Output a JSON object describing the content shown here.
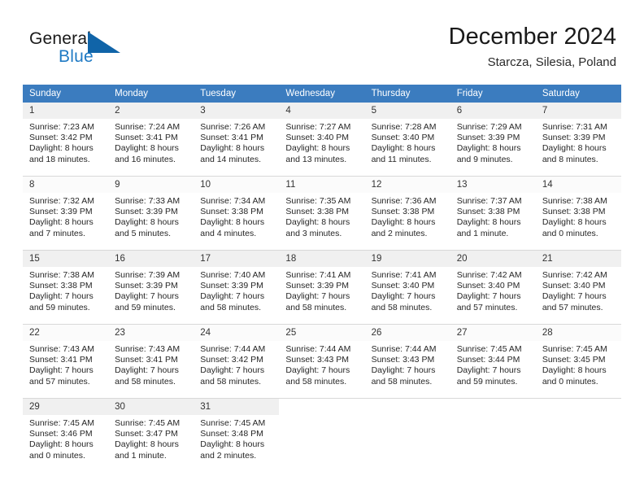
{
  "brand": {
    "line1": "General",
    "line2": "Blue",
    "mark": "triangle-logo"
  },
  "header": {
    "title": "December 2024",
    "subtitle": "Starcza, Silesia, Poland"
  },
  "colors": {
    "header_blue": "#3b7cbf",
    "brand_blue": "#1f7ac4",
    "daynum_band": "#f0f0f0",
    "row_divider": "#d8d8d8"
  },
  "weekdays": [
    "Sunday",
    "Monday",
    "Tuesday",
    "Wednesday",
    "Thursday",
    "Friday",
    "Saturday"
  ],
  "labels": {
    "sunrise_prefix": "Sunrise:",
    "sunset_prefix": "Sunset:",
    "daylight_prefix": "Daylight:"
  },
  "weeks": [
    [
      {
        "day": "1",
        "sunrise": "Sunrise: 7:23 AM",
        "sunset": "Sunset: 3:42 PM",
        "daylight1": "Daylight: 8 hours",
        "daylight2": "and 18 minutes."
      },
      {
        "day": "2",
        "sunrise": "Sunrise: 7:24 AM",
        "sunset": "Sunset: 3:41 PM",
        "daylight1": "Daylight: 8 hours",
        "daylight2": "and 16 minutes."
      },
      {
        "day": "3",
        "sunrise": "Sunrise: 7:26 AM",
        "sunset": "Sunset: 3:41 PM",
        "daylight1": "Daylight: 8 hours",
        "daylight2": "and 14 minutes."
      },
      {
        "day": "4",
        "sunrise": "Sunrise: 7:27 AM",
        "sunset": "Sunset: 3:40 PM",
        "daylight1": "Daylight: 8 hours",
        "daylight2": "and 13 minutes."
      },
      {
        "day": "5",
        "sunrise": "Sunrise: 7:28 AM",
        "sunset": "Sunset: 3:40 PM",
        "daylight1": "Daylight: 8 hours",
        "daylight2": "and 11 minutes."
      },
      {
        "day": "6",
        "sunrise": "Sunrise: 7:29 AM",
        "sunset": "Sunset: 3:39 PM",
        "daylight1": "Daylight: 8 hours",
        "daylight2": "and 9 minutes."
      },
      {
        "day": "7",
        "sunrise": "Sunrise: 7:31 AM",
        "sunset": "Sunset: 3:39 PM",
        "daylight1": "Daylight: 8 hours",
        "daylight2": "and 8 minutes."
      }
    ],
    [
      {
        "day": "8",
        "sunrise": "Sunrise: 7:32 AM",
        "sunset": "Sunset: 3:39 PM",
        "daylight1": "Daylight: 8 hours",
        "daylight2": "and 7 minutes."
      },
      {
        "day": "9",
        "sunrise": "Sunrise: 7:33 AM",
        "sunset": "Sunset: 3:39 PM",
        "daylight1": "Daylight: 8 hours",
        "daylight2": "and 5 minutes."
      },
      {
        "day": "10",
        "sunrise": "Sunrise: 7:34 AM",
        "sunset": "Sunset: 3:38 PM",
        "daylight1": "Daylight: 8 hours",
        "daylight2": "and 4 minutes."
      },
      {
        "day": "11",
        "sunrise": "Sunrise: 7:35 AM",
        "sunset": "Sunset: 3:38 PM",
        "daylight1": "Daylight: 8 hours",
        "daylight2": "and 3 minutes."
      },
      {
        "day": "12",
        "sunrise": "Sunrise: 7:36 AM",
        "sunset": "Sunset: 3:38 PM",
        "daylight1": "Daylight: 8 hours",
        "daylight2": "and 2 minutes."
      },
      {
        "day": "13",
        "sunrise": "Sunrise: 7:37 AM",
        "sunset": "Sunset: 3:38 PM",
        "daylight1": "Daylight: 8 hours",
        "daylight2": "and 1 minute."
      },
      {
        "day": "14",
        "sunrise": "Sunrise: 7:38 AM",
        "sunset": "Sunset: 3:38 PM",
        "daylight1": "Daylight: 8 hours",
        "daylight2": "and 0 minutes."
      }
    ],
    [
      {
        "day": "15",
        "sunrise": "Sunrise: 7:38 AM",
        "sunset": "Sunset: 3:38 PM",
        "daylight1": "Daylight: 7 hours",
        "daylight2": "and 59 minutes."
      },
      {
        "day": "16",
        "sunrise": "Sunrise: 7:39 AM",
        "sunset": "Sunset: 3:39 PM",
        "daylight1": "Daylight: 7 hours",
        "daylight2": "and 59 minutes."
      },
      {
        "day": "17",
        "sunrise": "Sunrise: 7:40 AM",
        "sunset": "Sunset: 3:39 PM",
        "daylight1": "Daylight: 7 hours",
        "daylight2": "and 58 minutes."
      },
      {
        "day": "18",
        "sunrise": "Sunrise: 7:41 AM",
        "sunset": "Sunset: 3:39 PM",
        "daylight1": "Daylight: 7 hours",
        "daylight2": "and 58 minutes."
      },
      {
        "day": "19",
        "sunrise": "Sunrise: 7:41 AM",
        "sunset": "Sunset: 3:40 PM",
        "daylight1": "Daylight: 7 hours",
        "daylight2": "and 58 minutes."
      },
      {
        "day": "20",
        "sunrise": "Sunrise: 7:42 AM",
        "sunset": "Sunset: 3:40 PM",
        "daylight1": "Daylight: 7 hours",
        "daylight2": "and 57 minutes."
      },
      {
        "day": "21",
        "sunrise": "Sunrise: 7:42 AM",
        "sunset": "Sunset: 3:40 PM",
        "daylight1": "Daylight: 7 hours",
        "daylight2": "and 57 minutes."
      }
    ],
    [
      {
        "day": "22",
        "sunrise": "Sunrise: 7:43 AM",
        "sunset": "Sunset: 3:41 PM",
        "daylight1": "Daylight: 7 hours",
        "daylight2": "and 57 minutes."
      },
      {
        "day": "23",
        "sunrise": "Sunrise: 7:43 AM",
        "sunset": "Sunset: 3:41 PM",
        "daylight1": "Daylight: 7 hours",
        "daylight2": "and 58 minutes."
      },
      {
        "day": "24",
        "sunrise": "Sunrise: 7:44 AM",
        "sunset": "Sunset: 3:42 PM",
        "daylight1": "Daylight: 7 hours",
        "daylight2": "and 58 minutes."
      },
      {
        "day": "25",
        "sunrise": "Sunrise: 7:44 AM",
        "sunset": "Sunset: 3:43 PM",
        "daylight1": "Daylight: 7 hours",
        "daylight2": "and 58 minutes."
      },
      {
        "day": "26",
        "sunrise": "Sunrise: 7:44 AM",
        "sunset": "Sunset: 3:43 PM",
        "daylight1": "Daylight: 7 hours",
        "daylight2": "and 58 minutes."
      },
      {
        "day": "27",
        "sunrise": "Sunrise: 7:45 AM",
        "sunset": "Sunset: 3:44 PM",
        "daylight1": "Daylight: 7 hours",
        "daylight2": "and 59 minutes."
      },
      {
        "day": "28",
        "sunrise": "Sunrise: 7:45 AM",
        "sunset": "Sunset: 3:45 PM",
        "daylight1": "Daylight: 8 hours",
        "daylight2": "and 0 minutes."
      }
    ],
    [
      {
        "day": "29",
        "sunrise": "Sunrise: 7:45 AM",
        "sunset": "Sunset: 3:46 PM",
        "daylight1": "Daylight: 8 hours",
        "daylight2": "and 0 minutes."
      },
      {
        "day": "30",
        "sunrise": "Sunrise: 7:45 AM",
        "sunset": "Sunset: 3:47 PM",
        "daylight1": "Daylight: 8 hours",
        "daylight2": "and 1 minute."
      },
      {
        "day": "31",
        "sunrise": "Sunrise: 7:45 AM",
        "sunset": "Sunset: 3:48 PM",
        "daylight1": "Daylight: 8 hours",
        "daylight2": "and 2 minutes."
      },
      {
        "day": "",
        "sunrise": "",
        "sunset": "",
        "daylight1": "",
        "daylight2": ""
      },
      {
        "day": "",
        "sunrise": "",
        "sunset": "",
        "daylight1": "",
        "daylight2": ""
      },
      {
        "day": "",
        "sunrise": "",
        "sunset": "",
        "daylight1": "",
        "daylight2": ""
      },
      {
        "day": "",
        "sunrise": "",
        "sunset": "",
        "daylight1": "",
        "daylight2": ""
      }
    ]
  ]
}
